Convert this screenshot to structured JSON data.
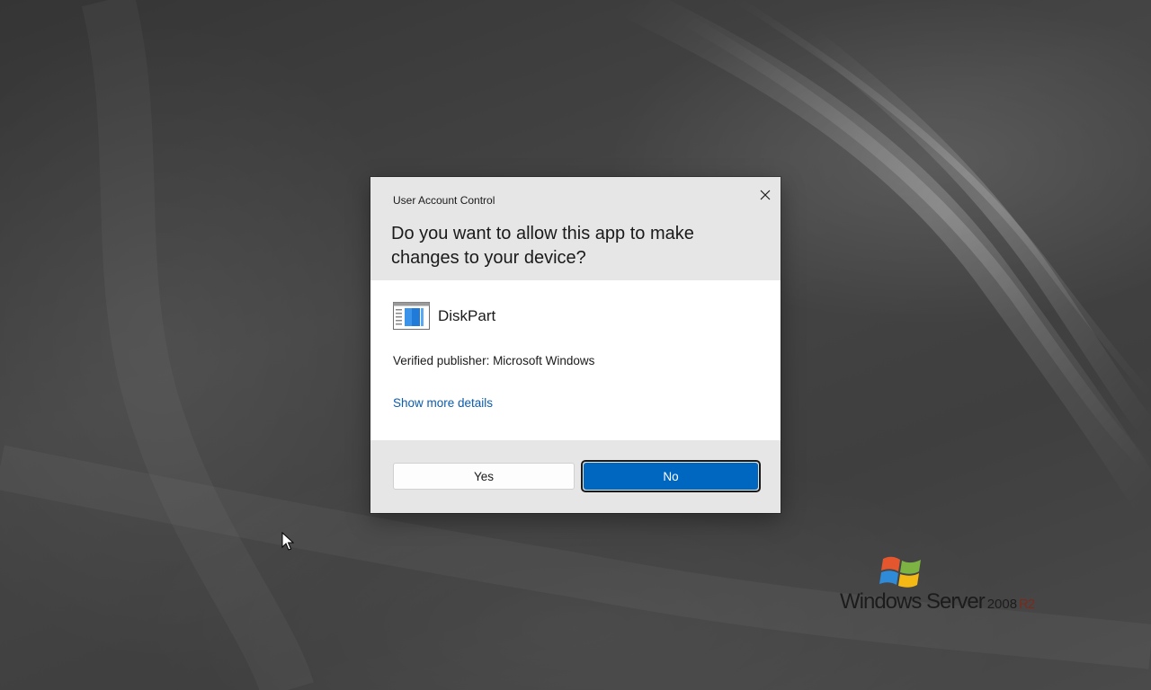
{
  "dialog": {
    "title": "User Account Control",
    "question": "Do you want to allow this app to make changes to your device?",
    "app_name": "DiskPart",
    "app_icon": "diskpart-app-icon",
    "publisher": "Verified publisher: Microsoft Windows",
    "details_link": "Show more details",
    "yes_label": "Yes",
    "no_label": "No",
    "close_icon": "close-icon",
    "accent_color": "#0067c0"
  },
  "desktop": {
    "os_brand": "Windows Server",
    "os_version": "2008",
    "os_release": "R2",
    "logo_icon": "windows-flag-icon"
  }
}
